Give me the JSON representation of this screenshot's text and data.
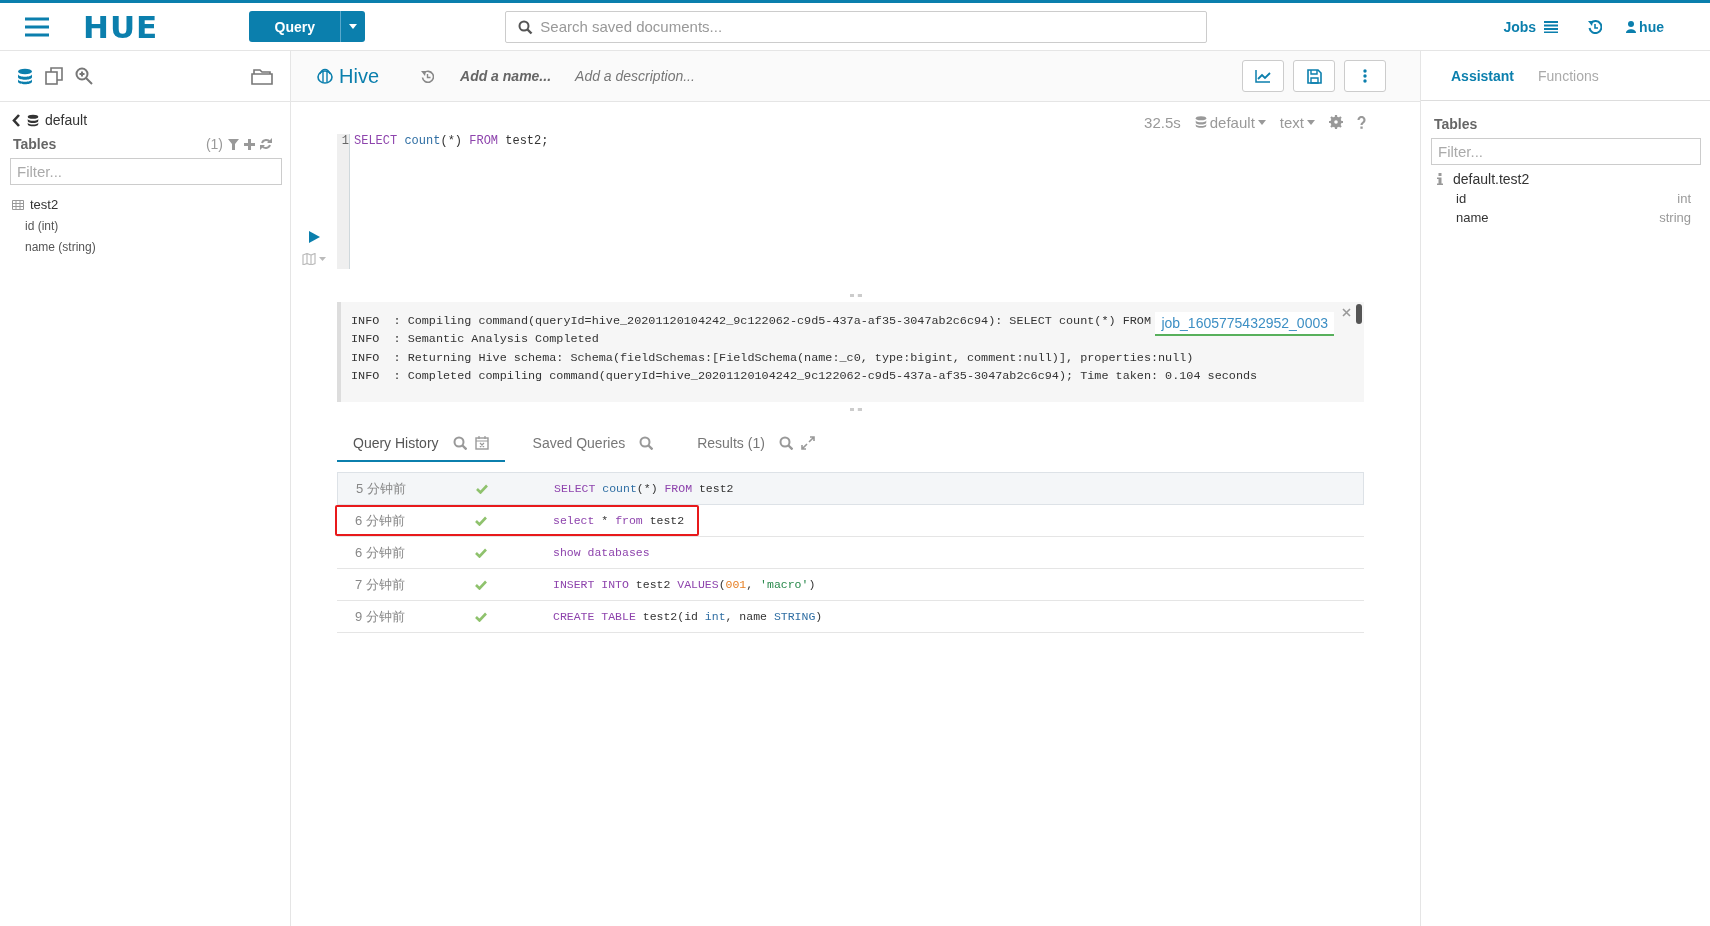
{
  "topbar": {
    "logo": "HUE",
    "query_button": "Query",
    "search": {
      "placeholder": "Search saved documents..."
    },
    "jobs": "Jobs",
    "user": "hue"
  },
  "left_panel": {
    "database": "default",
    "section_title": "Tables",
    "count": "(1)",
    "filter": {
      "placeholder": "Filter..."
    },
    "tables": [
      {
        "name": "test2",
        "children": [
          {
            "name": "id (int)"
          },
          {
            "name": "name (string)"
          }
        ]
      }
    ]
  },
  "editor": {
    "type": "Hive",
    "name_placeholder": "Add a name...",
    "description_placeholder": "Add a description...",
    "elapsed": "32.5s",
    "database": "default",
    "format": "text",
    "lines": [
      {
        "number": "1",
        "tokens": [
          {
            "text": "SELECT ",
            "kind": "keyword"
          },
          {
            "text": "count",
            "kind": "function"
          },
          {
            "text": "(*) ",
            "kind": "plain"
          },
          {
            "text": "FROM",
            "kind": "keyword"
          },
          {
            "text": " test2;",
            "kind": "plain"
          }
        ]
      }
    ],
    "log": {
      "lines": [
        "INFO  : Compiling command(queryId=hive_20201120104242_9c122062-c9d5-437a-af35-3047ab2c6c94): SELECT count(*) FROM",
        "INFO  : Semantic Analysis Completed",
        "INFO  : Returning Hive schema: Schema(fieldSchemas:[FieldSchema(name:_c0, type:bigint, comment:null)], properties:null)",
        "INFO  : Completed compiling command(queryId=hive_20201120104242_9c122062-c9d5-437a-af35-3047ab2c6c94); Time taken: 0.104 seconds"
      ],
      "job_link": "job_1605775432952_0003"
    },
    "tabs": [
      {
        "label": "Query History",
        "selected": true
      },
      {
        "label": "Saved Queries",
        "selected": false
      },
      {
        "label": "Results (1)",
        "selected": false
      }
    ],
    "history": [
      {
        "time": "5 分钟前",
        "success": true,
        "selected": true,
        "annotated": false,
        "tokens": [
          {
            "text": "SELECT ",
            "kind": "keyword"
          },
          {
            "text": "count",
            "kind": "function"
          },
          {
            "text": "(*) ",
            "kind": "plain"
          },
          {
            "text": "FROM",
            "kind": "keyword"
          },
          {
            "text": " test2",
            "kind": "plain"
          }
        ]
      },
      {
        "time": "6 分钟前",
        "success": true,
        "selected": false,
        "annotated": true,
        "tokens": [
          {
            "text": "select",
            "kind": "keyword"
          },
          {
            "text": " * ",
            "kind": "plain"
          },
          {
            "text": "from",
            "kind": "keyword"
          },
          {
            "text": " test2",
            "kind": "plain"
          }
        ]
      },
      {
        "time": "6 分钟前",
        "success": true,
        "selected": false,
        "annotated": false,
        "tokens": [
          {
            "text": "show databases",
            "kind": "keyword"
          }
        ]
      },
      {
        "time": "7 分钟前",
        "success": true,
        "selected": false,
        "annotated": false,
        "tokens": [
          {
            "text": "INSERT INTO",
            "kind": "keyword"
          },
          {
            "text": " test2 ",
            "kind": "plain"
          },
          {
            "text": "VALUES",
            "kind": "keyword"
          },
          {
            "text": "(",
            "kind": "plain"
          },
          {
            "text": "001",
            "kind": "number"
          },
          {
            "text": ", ",
            "kind": "plain"
          },
          {
            "text": "'macro'",
            "kind": "string"
          },
          {
            "text": ")",
            "kind": "plain"
          }
        ]
      },
      {
        "time": "9 分钟前",
        "success": true,
        "selected": false,
        "annotated": false,
        "tokens": [
          {
            "text": "CREATE TABLE",
            "kind": "keyword"
          },
          {
            "text": " test2(id ",
            "kind": "plain"
          },
          {
            "text": "int",
            "kind": "function"
          },
          {
            "text": ", name ",
            "kind": "plain"
          },
          {
            "text": "STRING",
            "kind": "function"
          },
          {
            "text": ")",
            "kind": "plain"
          }
        ]
      }
    ]
  },
  "assistant": {
    "tabs": [
      {
        "label": "Assistant",
        "selected": true
      },
      {
        "label": "Functions",
        "selected": false
      }
    ],
    "section_title": "Tables",
    "filter": {
      "placeholder": "Filter..."
    },
    "table": "default.test2",
    "columns": [
      {
        "name": "id",
        "type": "int"
      },
      {
        "name": "name",
        "type": "string"
      }
    ]
  }
}
